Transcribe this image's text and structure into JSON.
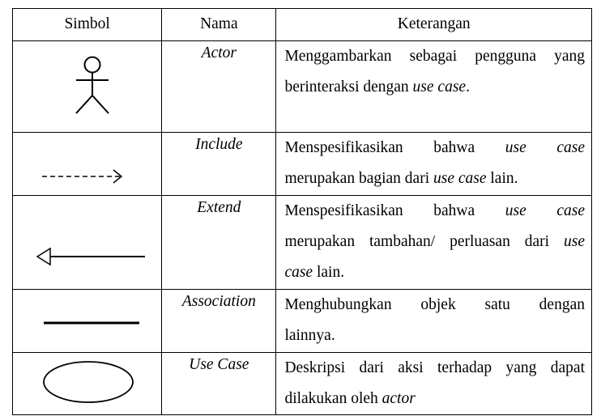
{
  "header": {
    "symbol": "Simbol",
    "name": "Nama",
    "description": "Keterangan"
  },
  "rows": [
    {
      "icon": "actor-stick-figure-icon",
      "name": "Actor",
      "desc_lines": [
        {
          "a": "Menggambarkan sebagai pengguna yang",
          "b": "",
          "c": ""
        },
        {
          "a": "berinteraksi dengan ",
          "b": "use case",
          "c": "."
        }
      ]
    },
    {
      "icon": "dashed-arrow-icon",
      "name": "Include",
      "desc_lines": [
        {
          "a": "Menspesifikasikan bahwa ",
          "b": "use case",
          "c": ""
        },
        {
          "a": "merupakan bagian dari ",
          "b": "use case",
          "c": " lain."
        }
      ]
    },
    {
      "icon": "open-triangle-arrow-icon",
      "name": "Extend",
      "desc_lines": [
        {
          "a": "Menspesifikasikan bahwa ",
          "b": "use case",
          "c": ""
        },
        {
          "a": "merupakan tambahan/ perluasan dari ",
          "b": "use",
          "c": ""
        },
        {
          "a": "",
          "b": "case",
          "c": " lain."
        }
      ]
    },
    {
      "icon": "solid-line-icon",
      "name": "Association",
      "desc_lines": [
        {
          "a": "Menghubungkan objek satu dengan",
          "b": "",
          "c": ""
        },
        {
          "a": "lainnya.",
          "b": "",
          "c": ""
        }
      ]
    },
    {
      "icon": "ellipse-icon",
      "name": "Use Case",
      "desc_lines": [
        {
          "a": "Deskripsi dari aksi terhadap yang dapat",
          "b": "",
          "c": ""
        },
        {
          "a": "dilakukan oleh ",
          "b": "actor",
          "c": ""
        }
      ]
    }
  ]
}
